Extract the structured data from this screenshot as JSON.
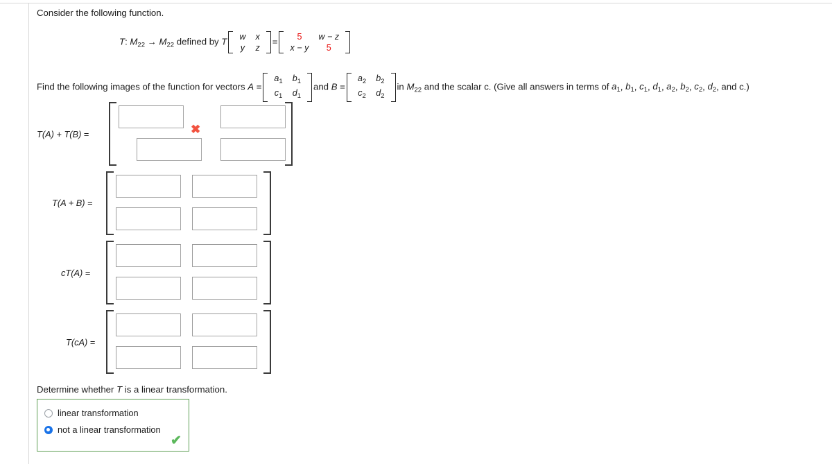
{
  "page": {
    "intro": "Consider the following function.",
    "find_instruction_pre": "Find the following images of the function for vectors",
    "determine_prompt": "Determine whether T is a linear transformation."
  },
  "definition": {
    "map_T": "T",
    "colon": ":",
    "domain": "M",
    "domain_sub": "22",
    "arrow": "→",
    "codomain": "M",
    "codomain_sub": "22",
    "defined_by": "defined by",
    "T_applied": "T",
    "input_matrix": [
      [
        "w",
        "x"
      ],
      [
        "y",
        "z"
      ]
    ],
    "equals": "=",
    "output_matrix": [
      [
        "5",
        "w − z"
      ],
      [
        "x − y",
        "5"
      ]
    ],
    "highlight_color": "#e8110f",
    "highlighted_cells": [
      "5",
      "5"
    ]
  },
  "statement": {
    "lead": "Find the following images of the function for vectors",
    "A_label": "A",
    "A_equals": "=",
    "A_matrix": [
      [
        "a",
        "b"
      ],
      [
        "c",
        "d"
      ]
    ],
    "A_subscripts": [
      [
        "1",
        "1"
      ],
      [
        "1",
        "1"
      ]
    ],
    "and_text": "and",
    "B_label": "B",
    "B_equals": "=",
    "B_matrix": [
      [
        "a",
        "b"
      ],
      [
        "c",
        "d"
      ]
    ],
    "B_subscripts": [
      [
        "2",
        "2"
      ],
      [
        "2",
        "2"
      ]
    ],
    "in_text": "in",
    "space_M": "M",
    "space_M_sub": "22",
    "scalar_text": "and the scalar c. (Give all answers in terms of",
    "terms_list": [
      "a₁",
      "b₁",
      "c₁",
      "d₁",
      "a₂",
      "b₂",
      "c₂",
      "d₂"
    ],
    "terms_tail": "and c.)"
  },
  "answers": [
    {
      "label": "T(A) + T(B)",
      "equals": "=",
      "cells": [
        "",
        "",
        "",
        ""
      ],
      "placeholders": [
        "",
        "",
        "",
        ""
      ],
      "mark": "cross",
      "mark_glyph": "✖",
      "mark_color": "#f2523f"
    },
    {
      "label": "T(A + B)",
      "equals": "=",
      "cells": [
        "",
        "",
        "",
        ""
      ],
      "placeholders": [
        "",
        "",
        "",
        ""
      ],
      "mark": "none",
      "mark_glyph": "",
      "mark_color": ""
    },
    {
      "label": "cT(A)",
      "equals": "=",
      "cells": [
        "",
        "",
        "",
        ""
      ],
      "placeholders": [
        "",
        "",
        "",
        ""
      ],
      "mark": "none",
      "mark_glyph": "",
      "mark_color": ""
    },
    {
      "label": "T(cA)",
      "equals": "=",
      "cells": [
        "",
        "",
        "",
        ""
      ],
      "placeholders": [
        "",
        "",
        "",
        ""
      ],
      "mark": "none",
      "mark_glyph": "",
      "mark_color": ""
    }
  ],
  "radio_group": {
    "border_color": "#5d9e53",
    "selected_index": 1,
    "options": [
      {
        "label": "linear transformation",
        "selected": false
      },
      {
        "label": "not a linear transformation",
        "selected": true
      }
    ],
    "mark_glyph": "✔",
    "mark_color": "#5cb85c"
  }
}
